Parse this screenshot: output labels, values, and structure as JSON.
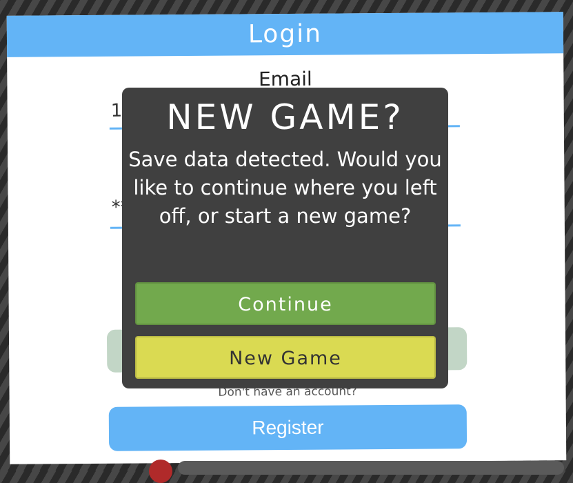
{
  "login": {
    "title": "Login",
    "email_label": "Email",
    "email_value": "1(",
    "password_value": "**",
    "no_account": "Don't have an account?",
    "register": "Register"
  },
  "modal": {
    "title": "NEW GAME?",
    "message": "Save data detected. Would you like to continue where you left off, or start a new game?",
    "continue": "Continue",
    "new_game": "New Game"
  }
}
